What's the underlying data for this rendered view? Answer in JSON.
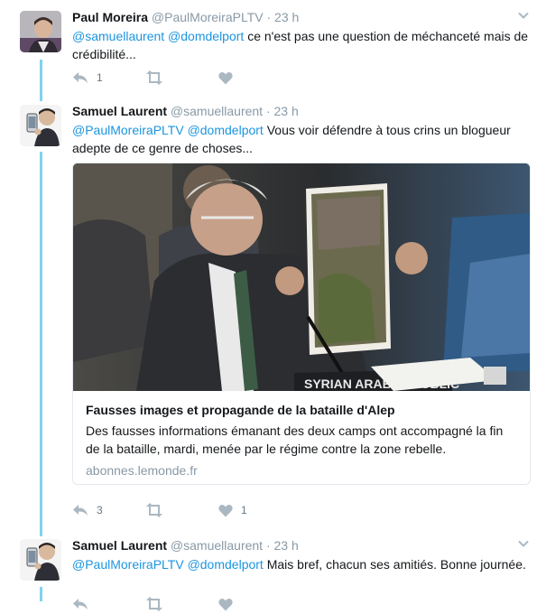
{
  "tweets": [
    {
      "name": "Paul Moreira",
      "handle": "@PaulMoreiraPLTV",
      "time": "· 23 h",
      "text": {
        "mentions": [
          "@samuellaurent",
          "@domdelport"
        ],
        "line": "ce n'est pas une question de méchanceté mais de crédibilité..."
      },
      "actions": {
        "reply_count": "1",
        "retweet_count": "",
        "like_count": ""
      }
    },
    {
      "name": "Samuel Laurent",
      "handle": "@samuellaurent",
      "time": "· 23 h",
      "text": {
        "mentions": [
          "@PaulMoreiraPLTV",
          "@domdelport"
        ],
        "line": "Vous voir défendre à tous crins un blogueur adepte de ce genre de choses..."
      },
      "card": {
        "image_caption": "SYRIAN ARAB REPUBLIC",
        "title": "Fausses images et propagande de la bataille d'Alep",
        "description": "Des fausses informations émanant des deux camps ont accompagné la fin de la bataille, mardi, menée par le régime contre la zone rebelle.",
        "domain": "abonnes.lemonde.fr"
      },
      "actions": {
        "reply_count": "3",
        "retweet_count": "",
        "like_count": "1"
      }
    },
    {
      "name": "Samuel Laurent",
      "handle": "@samuellaurent",
      "time": "· 23 h",
      "text": {
        "mentions": [
          "@PaulMoreiraPLTV",
          "@domdelport"
        ],
        "line": "Mais bref, chacun ses amitiés. Bonne journée."
      }
    }
  ],
  "colors": {
    "link": "#1b95e0",
    "thread_line": "#7fd3f2",
    "secondary_text": "#8899a6",
    "action_icon": "#aab8c2"
  },
  "icons": {
    "caret": "chevron-down-icon",
    "reply": "reply-icon",
    "retweet": "retweet-icon",
    "like": "heart-icon"
  }
}
